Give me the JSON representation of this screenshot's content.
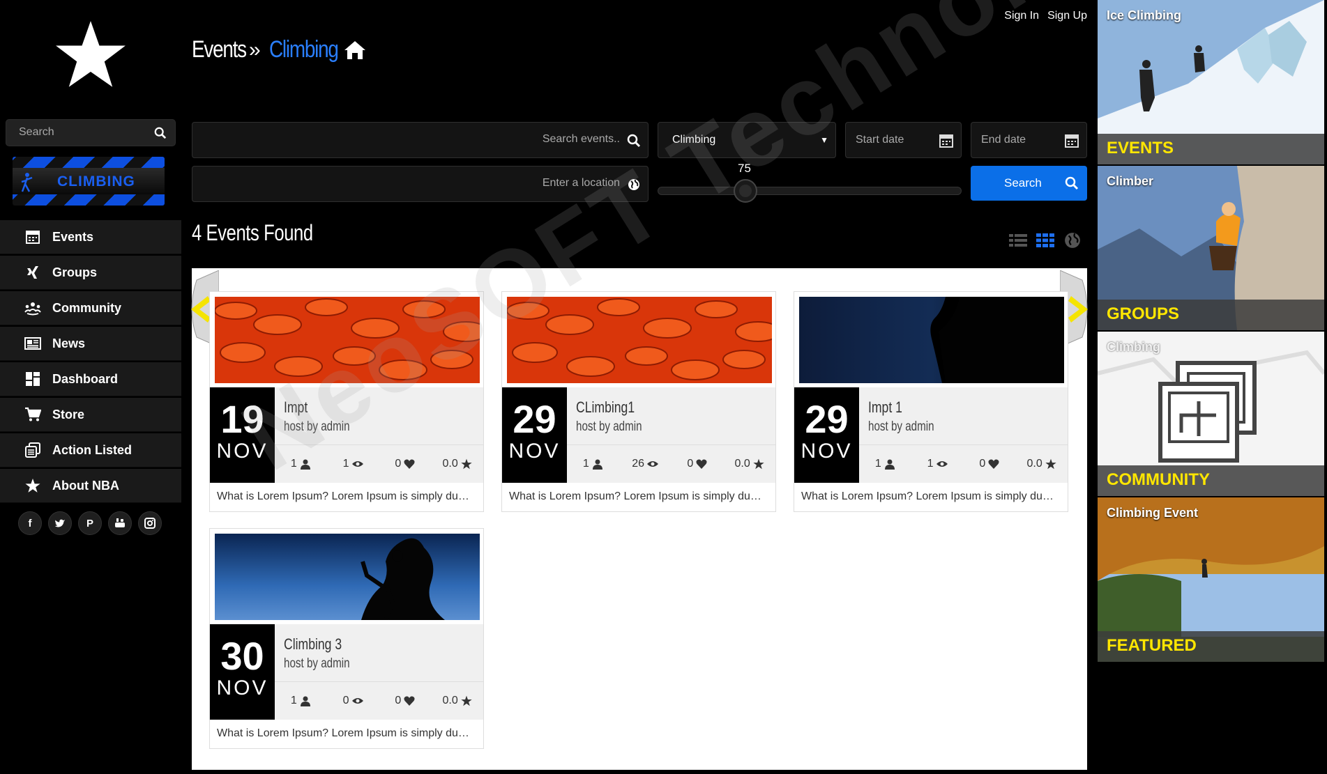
{
  "auth": {
    "sign_in": "Sign In",
    "sign_up": "Sign Up"
  },
  "breadcrumb": {
    "section": "Events",
    "separator": "»",
    "current": "Climbing"
  },
  "sidebar": {
    "search_placeholder": "Search",
    "banner_text": "CLIMBING",
    "items": [
      {
        "label": "Events",
        "icon": "calendar-icon"
      },
      {
        "label": "Groups",
        "icon": "xing-icon"
      },
      {
        "label": "Community",
        "icon": "community-icon"
      },
      {
        "label": "News",
        "icon": "newspaper-icon"
      },
      {
        "label": "Dashboard",
        "icon": "dashboard-icon"
      },
      {
        "label": "Store",
        "icon": "cart-icon"
      },
      {
        "label": "Action Listed",
        "icon": "copy-icon"
      },
      {
        "label": "About NBA",
        "icon": "star-icon"
      }
    ],
    "social": [
      "f",
      "t",
      "p",
      "yt",
      "ig"
    ]
  },
  "filters": {
    "search_placeholder": "Search events..",
    "category": "Climbing",
    "start_placeholder": "Start date",
    "end_placeholder": "End date",
    "location_placeholder": "Enter a location",
    "radius_value": "75",
    "search_button": "Search"
  },
  "results": {
    "found_text": "4 Events Found"
  },
  "events": [
    {
      "day": "19",
      "month": "NOV",
      "title": "Impt",
      "host": "host by admin",
      "attendees": "1",
      "views": "1",
      "likes": "0",
      "rating": "0.0",
      "description": "What is Lorem Ipsum? Lorem Ipsum is simply dummy text of the printing",
      "image": "orange-flower"
    },
    {
      "day": "29",
      "month": "NOV",
      "title": "CLimbing1",
      "host": "host by admin",
      "attendees": "1",
      "views": "26",
      "likes": "0",
      "rating": "0.0",
      "description": "What is Lorem Ipsum? Lorem Ipsum is simply dummy text of the printing",
      "image": "orange-flower"
    },
    {
      "day": "29",
      "month": "NOV",
      "title": "Impt 1",
      "host": "host by admin",
      "attendees": "1",
      "views": "1",
      "likes": "0",
      "rating": "0.0",
      "description": "What is Lorem Ipsum? Lorem Ipsum is simply dummy text of the printing",
      "image": "dark-climber"
    },
    {
      "day": "30",
      "month": "NOV",
      "title": "Climbing 3",
      "host": "host by admin",
      "attendees": "1",
      "views": "0",
      "likes": "0",
      "rating": "0.0",
      "description": "What is Lorem Ipsum? Lorem Ipsum is simply dummy text of the printing",
      "image": "sky-climber"
    }
  ],
  "right_panel": [
    {
      "caption": "Ice Climbing",
      "label": "EVENTS"
    },
    {
      "caption": "Climber",
      "label": "GROUPS"
    },
    {
      "caption": "Climbing",
      "label": "COMMUNITY"
    },
    {
      "caption": "Climbing Event",
      "label": "FEATURED"
    }
  ],
  "watermark": "NeoSOFT Technologies",
  "colors": {
    "accent": "#0b6fe8",
    "breadcrumb_active": "#2a7fff",
    "tile_label": "#ffe600",
    "arrow": "#f5e400"
  }
}
